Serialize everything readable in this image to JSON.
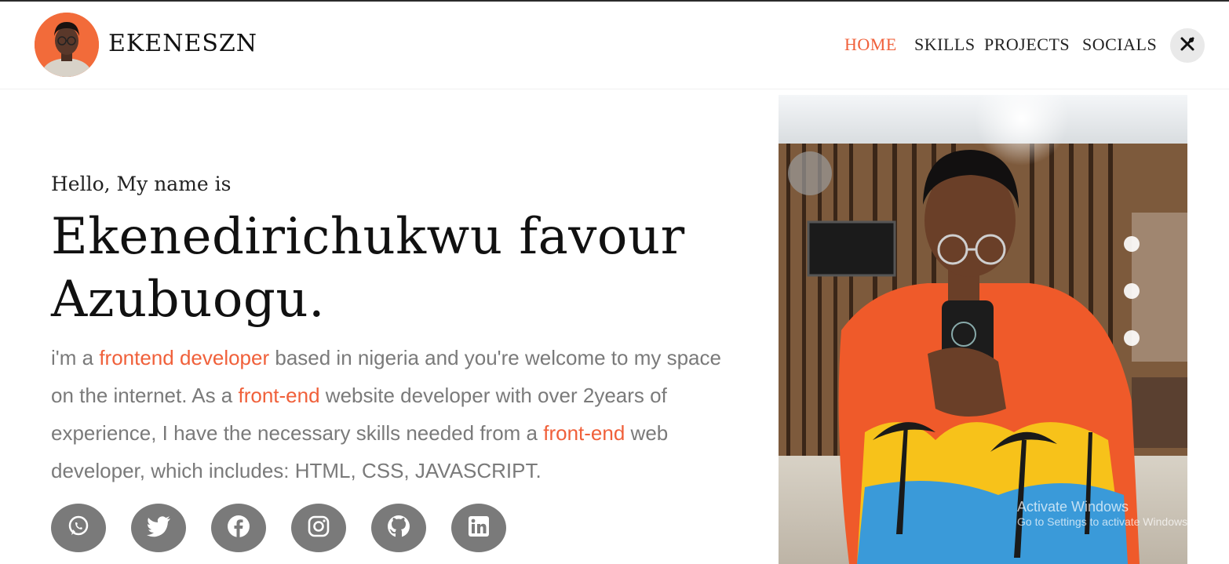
{
  "brand": {
    "name": "EKENESZN",
    "avatar_icon": "profile-avatar"
  },
  "nav": {
    "items": [
      {
        "label": "HOME",
        "active": true
      },
      {
        "label": "SKILLS",
        "active": false
      },
      {
        "label": "PROJECTS",
        "active": false
      },
      {
        "label": "SOCIALS",
        "active": false
      }
    ],
    "tools_icon": "tools-icon"
  },
  "hero": {
    "greeting": "Hello, My name is",
    "name": "Ekenedirichukwu favour Azubuogu.",
    "bio": [
      {
        "text": "i'm a ",
        "highlight": false
      },
      {
        "text": "frontend developer",
        "highlight": true
      },
      {
        "text": " based in nigeria and you're welcome to my space on the internet. As a ",
        "highlight": false
      },
      {
        "text": "front-end",
        "highlight": true
      },
      {
        "text": " website developer with over 2years of experience, I have the necessary skills needed from a ",
        "highlight": false
      },
      {
        "text": "front-end",
        "highlight": true
      },
      {
        "text": " web developer, which includes: HTML, CSS, JAVASCRIPT.",
        "highlight": false
      }
    ],
    "socials": [
      "whatsapp-icon",
      "twitter-icon",
      "facebook-icon",
      "instagram-icon",
      "github-icon",
      "linkedin-icon"
    ]
  },
  "watermark": {
    "title": "Activate Windows",
    "subtitle": "Go to Settings to activate Windows."
  },
  "colors": {
    "accent": "#f0603a",
    "text_muted": "#7a7a7a",
    "social_bg": "#7a7a7a"
  }
}
